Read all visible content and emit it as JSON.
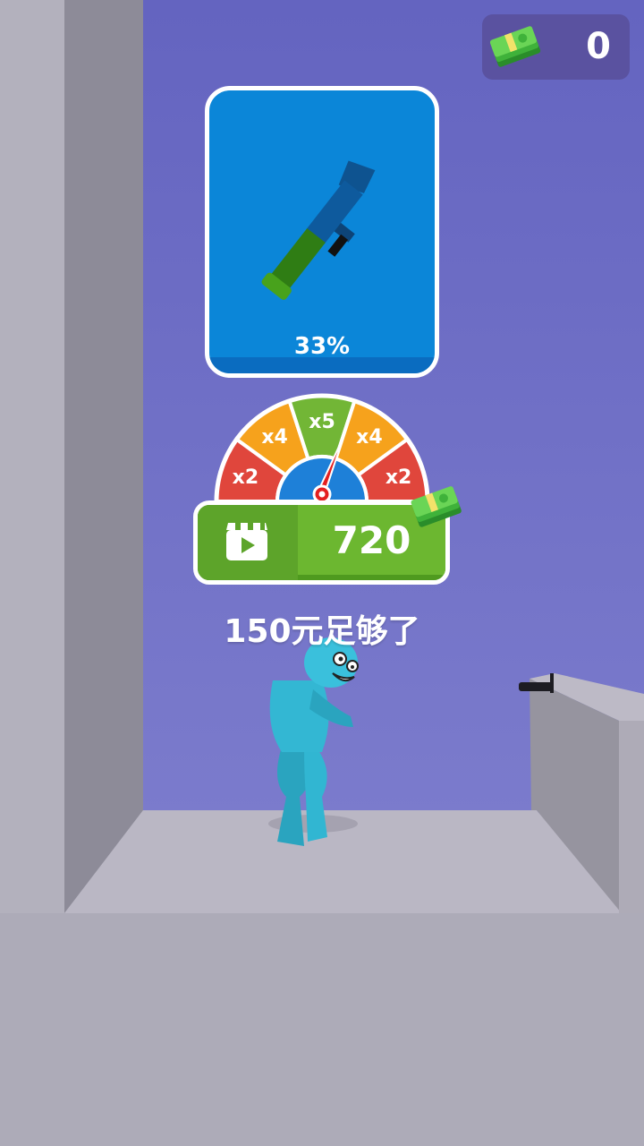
{
  "hud": {
    "money": "0",
    "cash_icon": "cash-stack-icon"
  },
  "weapon_card": {
    "progress_label": "33%",
    "progress": 0.33,
    "weapon_icon": "rocket-launcher-icon"
  },
  "multiplier_gauge": {
    "segments": [
      "x2",
      "x4",
      "x5",
      "x4",
      "x2"
    ],
    "colors": {
      "x2": "#e0463c",
      "x4": "#f6a21c",
      "x5": "#72b636",
      "center": "#1e80d8",
      "needle": "#e41f1f"
    }
  },
  "reward_button": {
    "amount": "720",
    "icon": "video-ad-icon"
  },
  "hint": "150元足够了",
  "colors": {
    "wall_back": "#6767c2",
    "floor": "#adabb8",
    "card": "#0b86d8",
    "button": "#6cb730"
  }
}
